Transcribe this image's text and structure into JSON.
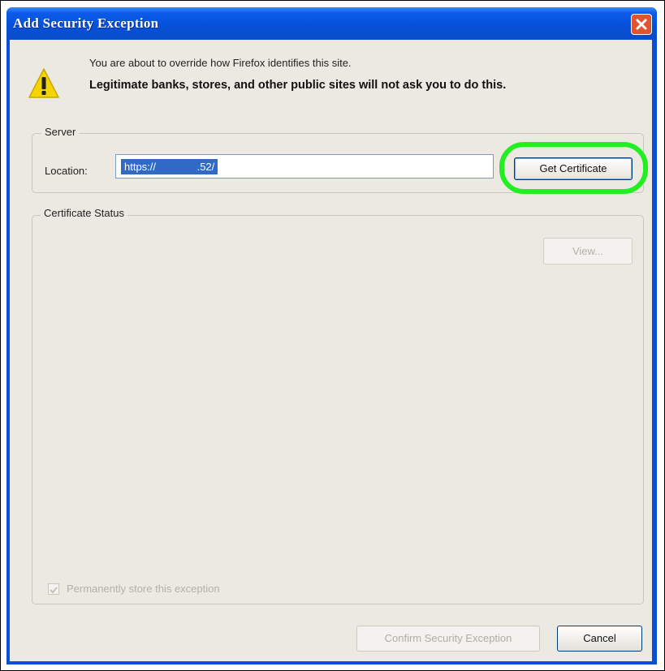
{
  "dialog": {
    "title": "Add Security Exception",
    "close_icon": "close-icon",
    "message_line1": "You are about to override how Firefox identifies this site.",
    "message_line2": "Legitimate banks, stores, and other public sites will not ask you to do this.",
    "warning_icon": "warning-triangle-icon"
  },
  "server": {
    "legend": "Server",
    "location_label": "Location:",
    "location_value": "https://              .52/",
    "get_certificate_label": "Get Certificate"
  },
  "certificate_status": {
    "legend": "Certificate Status",
    "view_label": "View...",
    "permanent_checkbox_label": "Permanently store this exception",
    "permanent_checked": true
  },
  "footer": {
    "confirm_label": "Confirm Security Exception",
    "cancel_label": "Cancel"
  },
  "colors": {
    "titlebar": "#0a5bea",
    "highlight": "#22ee22",
    "selection": "#316ac5"
  }
}
